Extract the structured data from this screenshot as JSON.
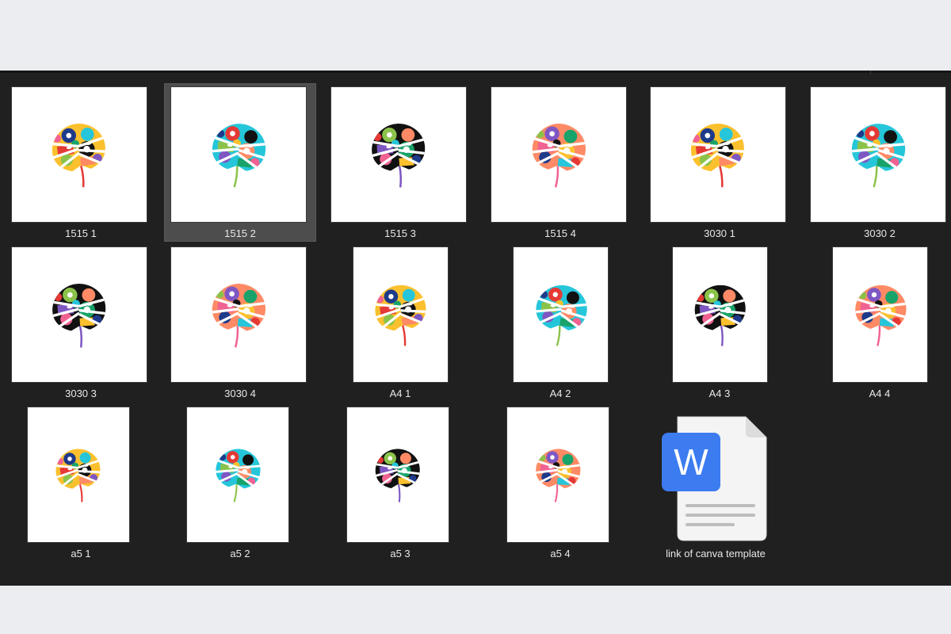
{
  "files": [
    {
      "name": "1515 1",
      "art": "leaf-colorful-icon",
      "variant": 1,
      "shape": "square",
      "selected": false
    },
    {
      "name": "1515 2",
      "art": "leaf-colorful-icon",
      "variant": 2,
      "shape": "square",
      "selected": true
    },
    {
      "name": "1515 3",
      "art": "leaf-colorful-icon",
      "variant": 3,
      "shape": "square",
      "selected": false
    },
    {
      "name": "1515 4",
      "art": "leaf-colorful-icon",
      "variant": 4,
      "shape": "square",
      "selected": false
    },
    {
      "name": "3030 1",
      "art": "leaf-colorful-icon",
      "variant": 1,
      "shape": "square",
      "selected": false
    },
    {
      "name": "3030 2",
      "art": "leaf-colorful-icon",
      "variant": 2,
      "shape": "square",
      "selected": false
    },
    {
      "name": "3030 3",
      "art": "leaf-colorful-icon",
      "variant": 3,
      "shape": "square",
      "selected": false
    },
    {
      "name": "3030 4",
      "art": "leaf-colorful-icon",
      "variant": 4,
      "shape": "square",
      "selected": false
    },
    {
      "name": "A4 1",
      "art": "leaf-colorful-icon",
      "variant": 1,
      "shape": "portrait",
      "selected": false
    },
    {
      "name": "A4 2",
      "art": "leaf-colorful-icon",
      "variant": 2,
      "shape": "portrait",
      "selected": false
    },
    {
      "name": "A4 3",
      "art": "leaf-colorful-icon",
      "variant": 3,
      "shape": "portrait",
      "selected": false
    },
    {
      "name": "A4 4",
      "art": "leaf-colorful-icon",
      "variant": 4,
      "shape": "portrait",
      "selected": false
    },
    {
      "name": "a5 1",
      "art": "leaf-colorful-icon",
      "variant": 1,
      "shape": "portrait",
      "selected": false
    },
    {
      "name": "a5 2",
      "art": "leaf-colorful-icon",
      "variant": 2,
      "shape": "portrait",
      "selected": false
    },
    {
      "name": "a5 3",
      "art": "leaf-colorful-icon",
      "variant": 3,
      "shape": "portrait",
      "selected": false
    },
    {
      "name": "a5 4",
      "art": "leaf-colorful-icon",
      "variant": 4,
      "shape": "portrait",
      "selected": false
    },
    {
      "name": "link of canva template",
      "art": "word-document-icon",
      "shape": "document",
      "selected": false
    }
  ],
  "doc_icon_letter": "W",
  "colors": {
    "background_light": "#ebedf0",
    "explorer_bg": "#202020",
    "label_text": "#e8e8e8",
    "selection_bg": "#4d4d4d",
    "word_blue": "#3c7cf0",
    "leaf_palette": [
      "#18a36b",
      "#f06292",
      "#fbc02d",
      "#1e3a8a",
      "#26c6da",
      "#e53935",
      "#111111",
      "#8bc34a",
      "#ff8a65",
      "#7e57c2"
    ]
  }
}
